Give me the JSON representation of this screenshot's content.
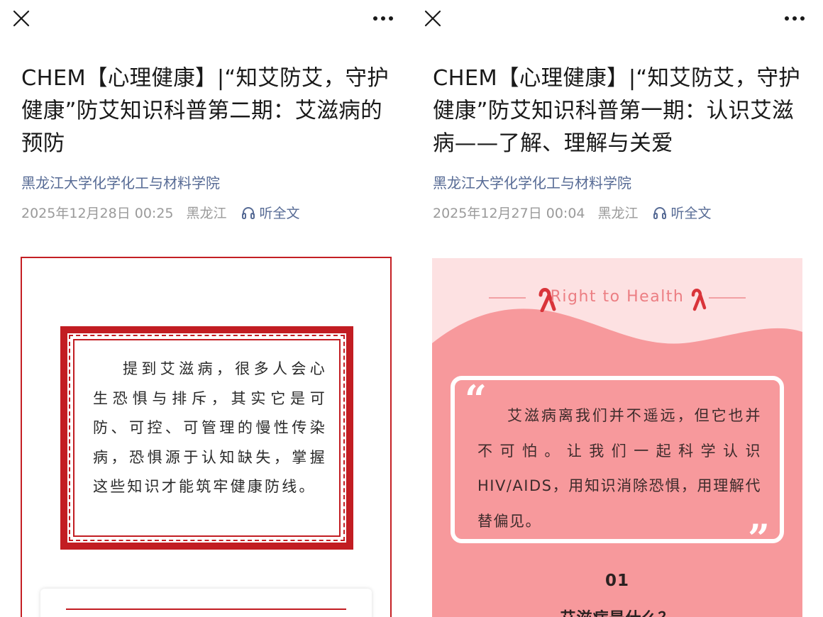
{
  "left": {
    "title": "CHEM【心理健康】|“知艾防艾，守护健康”防艾知识科普第二期：艾滋病的预防",
    "account": "黑龙江大学化学化工与材料学院",
    "date": "2025年12月28日 00:25",
    "location": "黑龙江",
    "listen": "听全文",
    "quote": "提到艾滋病，很多人会心生恐惧与排斥，其实它是可防、可控、可管理的慢性传染病，恐惧源于认知缺失，掌握这些知识才能筑牢健康防线。"
  },
  "right": {
    "title": "CHEM【心理健康】|“知艾防艾，守护健康”防艾知识科普第一期：认识艾滋病——了解、理解与关爱",
    "account": "黑龙江大学化学化工与材料学院",
    "date": "2025年12月27日 00:04",
    "location": "黑龙江",
    "listen": "听全文",
    "banner": "Right to Health",
    "quote": "艾滋病离我们并不遥远，但它也并不可怕。让我们一起科学认识HIV/AIDS，用知识消除恐惧，用理解代替偏见。",
    "section_number": "01",
    "section_title": "艾滋病是什么？"
  },
  "icons": {
    "close": "close-icon",
    "more": "more-icon",
    "headphones": "headphones-icon",
    "ribbon": "red-ribbon-icon"
  },
  "colors": {
    "link": "#576b95",
    "meta": "#9a9a9a",
    "red": "#c21d22",
    "pink_bg": "#fde1e2",
    "pink_wave": "#f7999c"
  }
}
